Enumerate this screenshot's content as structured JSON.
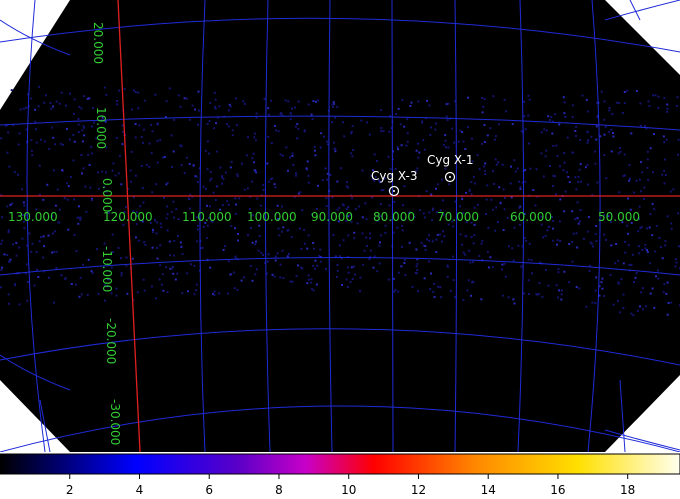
{
  "colors": {
    "background": "#000000",
    "outside": "#ffffff",
    "grid": "#1f2bd8",
    "equator": "#e02020",
    "grid_label": "#33cc33",
    "marker": "#ffffff"
  },
  "sources": [
    {
      "name": "Cyg X-3"
    },
    {
      "name": "Cyg X-1"
    }
  ],
  "longitude_labels": [
    "130.000",
    "120.000",
    "110.000",
    "100.000",
    "90.000",
    "80.000",
    "70.000",
    "60.000",
    "50.000"
  ],
  "latitude_labels": [
    "20.000",
    "10.000",
    "0.000",
    "-10.000",
    "-20.000",
    "-30.000"
  ],
  "colorbar": {
    "ticks": [
      "2",
      "4",
      "6",
      "8",
      "10",
      "12",
      "14",
      "16",
      "18"
    ],
    "min": 0,
    "max": 19.5,
    "colormap": "b"
  }
}
